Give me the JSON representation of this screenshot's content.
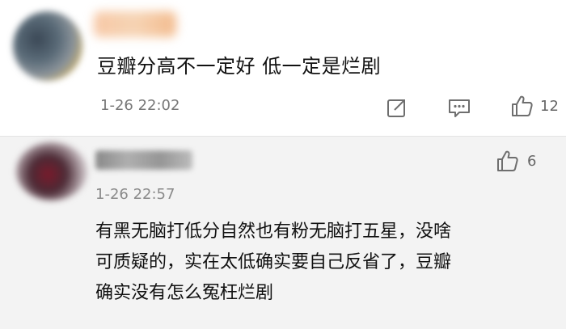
{
  "main_comment": {
    "text": "豆瓣分高不一定好 低一定是烂剧",
    "timestamp": "1-26 22:02",
    "like_count": "12"
  },
  "reply": {
    "timestamp": "1-26 22:57",
    "like_count": "6",
    "lines": [
      "有黑无脑打低分自然也有粉无脑打五星，没啥",
      "可质疑的，实在太低确实要自己反省了，豆瓣",
      "确实没有怎么冤枉烂剧"
    ]
  },
  "icons": {
    "share": "share-icon",
    "comment": "comment-icon",
    "like": "thumbs-up-icon"
  }
}
